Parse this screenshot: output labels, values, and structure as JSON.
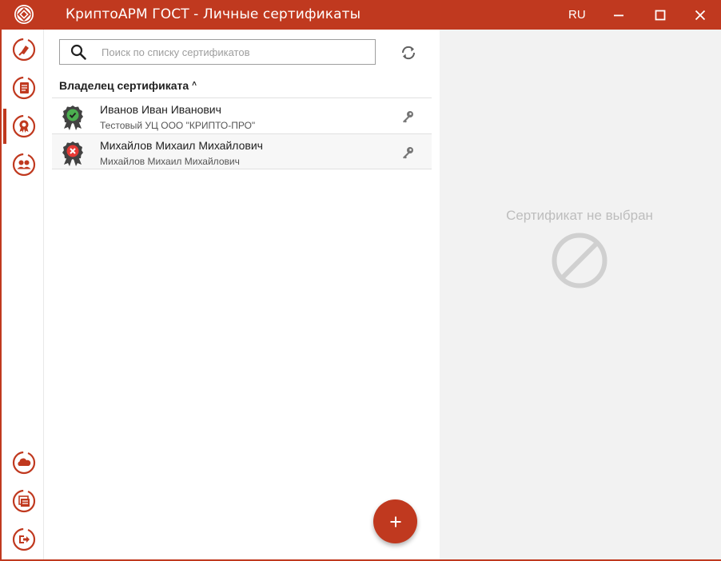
{
  "window": {
    "title": "КриптоАРМ ГОСТ - Личные сертификаты",
    "language": "RU"
  },
  "sidebar": {
    "items": [
      {
        "icon": "sign-icon",
        "active": false
      },
      {
        "icon": "documents-icon",
        "active": false
      },
      {
        "icon": "certificates-icon",
        "active": true
      },
      {
        "icon": "contacts-icon",
        "active": false
      },
      {
        "icon": "cloud-icon",
        "active": false
      },
      {
        "icon": "logs-icon",
        "active": false
      },
      {
        "icon": "exit-icon",
        "active": false
      }
    ]
  },
  "search": {
    "placeholder": "Поиск по списку сертификатов",
    "value": ""
  },
  "list": {
    "column_header": "Владелец сертификата",
    "sort_indicator": "˄",
    "certificates": [
      {
        "name": "Иванов Иван Иванович",
        "issuer": "Тестовый УЦ ООО \"КРИПТО-ПРО\"",
        "status": "valid"
      },
      {
        "name": "Михайлов Михаил Михайлович",
        "issuer": "Михайлов Михаил Михайлович",
        "status": "invalid"
      }
    ]
  },
  "detail": {
    "empty_text": "Сертификат не выбран"
  },
  "colors": {
    "accent": "#c0391f",
    "valid": "#4caf50",
    "invalid": "#d32f2f"
  }
}
